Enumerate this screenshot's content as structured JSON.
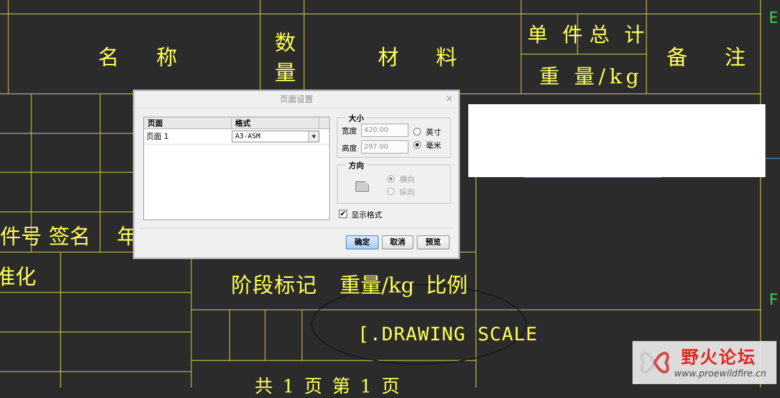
{
  "cad": {
    "header_name": "名 称",
    "header_qty_line1": "数",
    "header_qty_line2": "量",
    "header_material": "材 料",
    "header_unit": "单 件",
    "header_total": "总 计",
    "header_weight": "重 量/kg",
    "header_remark": "备 注",
    "left_partno": "件号",
    "left_sign": "签名",
    "left_year": "年",
    "left_std": "准化",
    "stage_mark": "阶段标记",
    "weight_kg": "重量/kg",
    "scale": "比例",
    "drawing_scale": "[.DRAWING SCALE",
    "sheet_info": "共 1 页 第 1 页",
    "letter_e": "E",
    "letter_f": "F"
  },
  "dialog": {
    "title": "页面设置",
    "close": "×",
    "table": {
      "col_page": "页面",
      "col_format": "格式",
      "row_page": "页面 1",
      "row_format": "A3-ASM"
    },
    "size": {
      "legend": "大小",
      "width_label": "宽度",
      "width_value": "420.00",
      "height_label": "高度",
      "height_value": "297.00",
      "unit_inch": "英寸",
      "unit_mm": "毫米",
      "selected_unit": "毫米"
    },
    "orientation": {
      "legend": "方向",
      "landscape": "横向",
      "portrait": "纵向",
      "selected": "横向"
    },
    "show_format_label": "显示格式",
    "show_format_checked": true,
    "ok_label": "确定",
    "cancel_label": "取消",
    "preview_label": "预览"
  },
  "watermark": {
    "title": "野火论坛",
    "url": "www.proewildfire.cn"
  },
  "colors": {
    "background": "#2b2b2b",
    "cad_lines": "#ffff55",
    "side_letters": "#39d353",
    "primary_button": "#a9cdf0"
  }
}
